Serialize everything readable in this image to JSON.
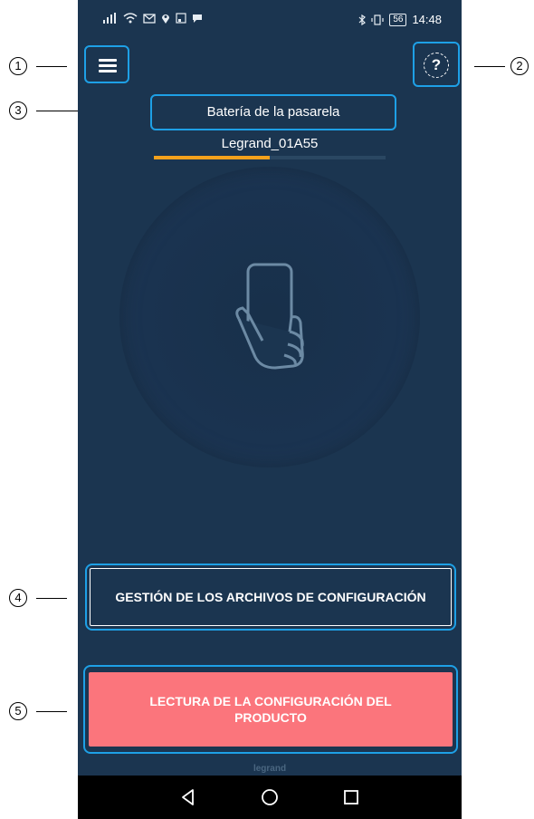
{
  "callouts": [
    "1",
    "2",
    "3",
    "4",
    "5"
  ],
  "status_bar": {
    "left_icons": [
      "signal-icon",
      "wifi-icon",
      "mail-icon",
      "location-icon",
      "cast-icon",
      "chat-icon"
    ],
    "right_icons": [
      "bluetooth-icon",
      "vibrate-icon"
    ],
    "battery": "56",
    "time": "14:48"
  },
  "header": {
    "menu_icon": "hamburger-icon",
    "help_icon": "question-icon",
    "help_symbol": "?"
  },
  "gateway": {
    "battery_label": "Batería de la pasarela",
    "name": "Legrand_01A55",
    "battery_level_percent": 50
  },
  "nfc": {
    "icon": "phone-in-hand-icon"
  },
  "buttons": {
    "config_files": "GESTIÓN DE LOS ARCHIVOS DE CONFIGURACIÓN",
    "read_config": "LECTURA DE LA CONFIGURACIÓN DEL PRODUCTO"
  },
  "brand": "legrand",
  "colors": {
    "background": "#1b3550",
    "highlight": "#1ea0e6",
    "progress": "#f4a11c",
    "primary_button": "#fb757c"
  },
  "navbar": {
    "icons": [
      "back-icon",
      "home-icon",
      "recents-icon"
    ]
  }
}
